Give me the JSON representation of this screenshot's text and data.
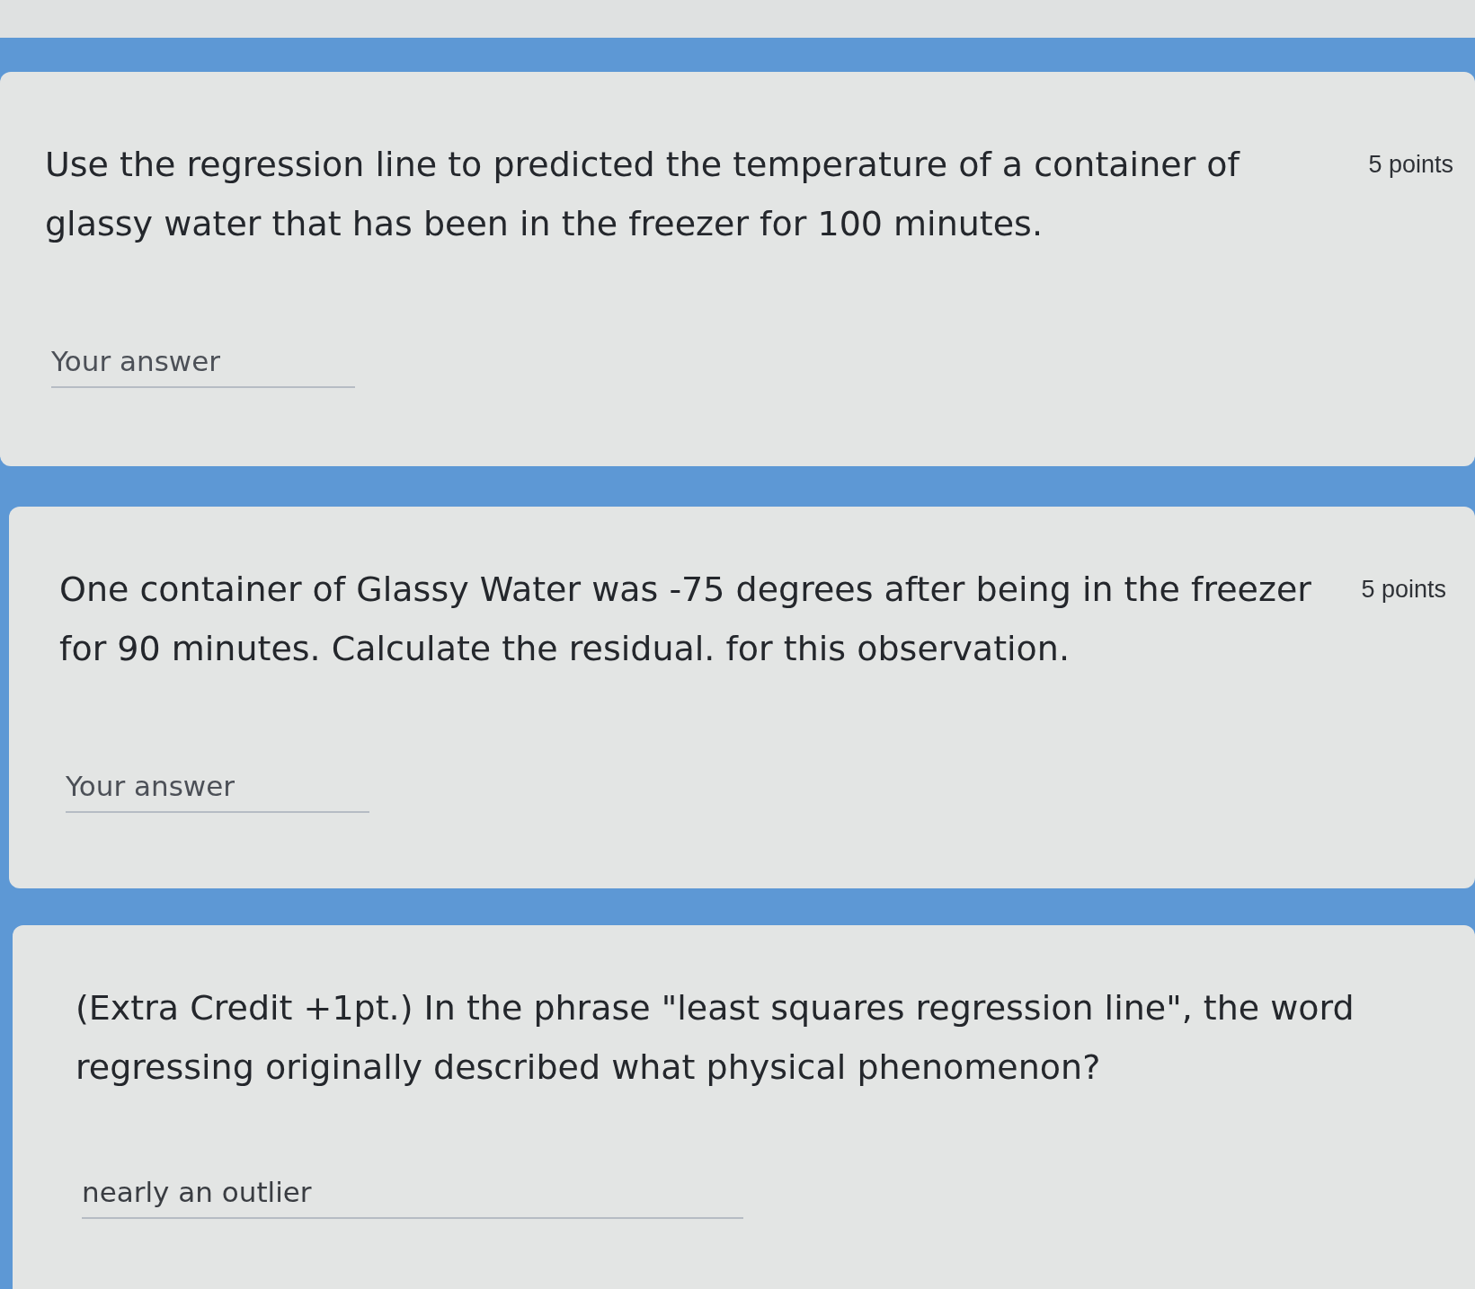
{
  "questions": [
    {
      "text": "Use the regression line to predicted the temperature of a container of glassy water that has been in the freezer for 100 minutes.",
      "points": "5 points",
      "answer": {
        "placeholder": "Your answer"
      }
    },
    {
      "text": "One container of Glassy Water was -75 degrees after being in the freezer for 90 minutes. Calculate the residual. for this observation.",
      "points": "5 points",
      "answer": {
        "placeholder": "Your answer"
      }
    },
    {
      "text": "(Extra Credit +1pt.) In the phrase \"least squares regression line\", the word regressing originally described what physical phenomenon?",
      "answer": {
        "value": "nearly an outlier"
      }
    }
  ]
}
